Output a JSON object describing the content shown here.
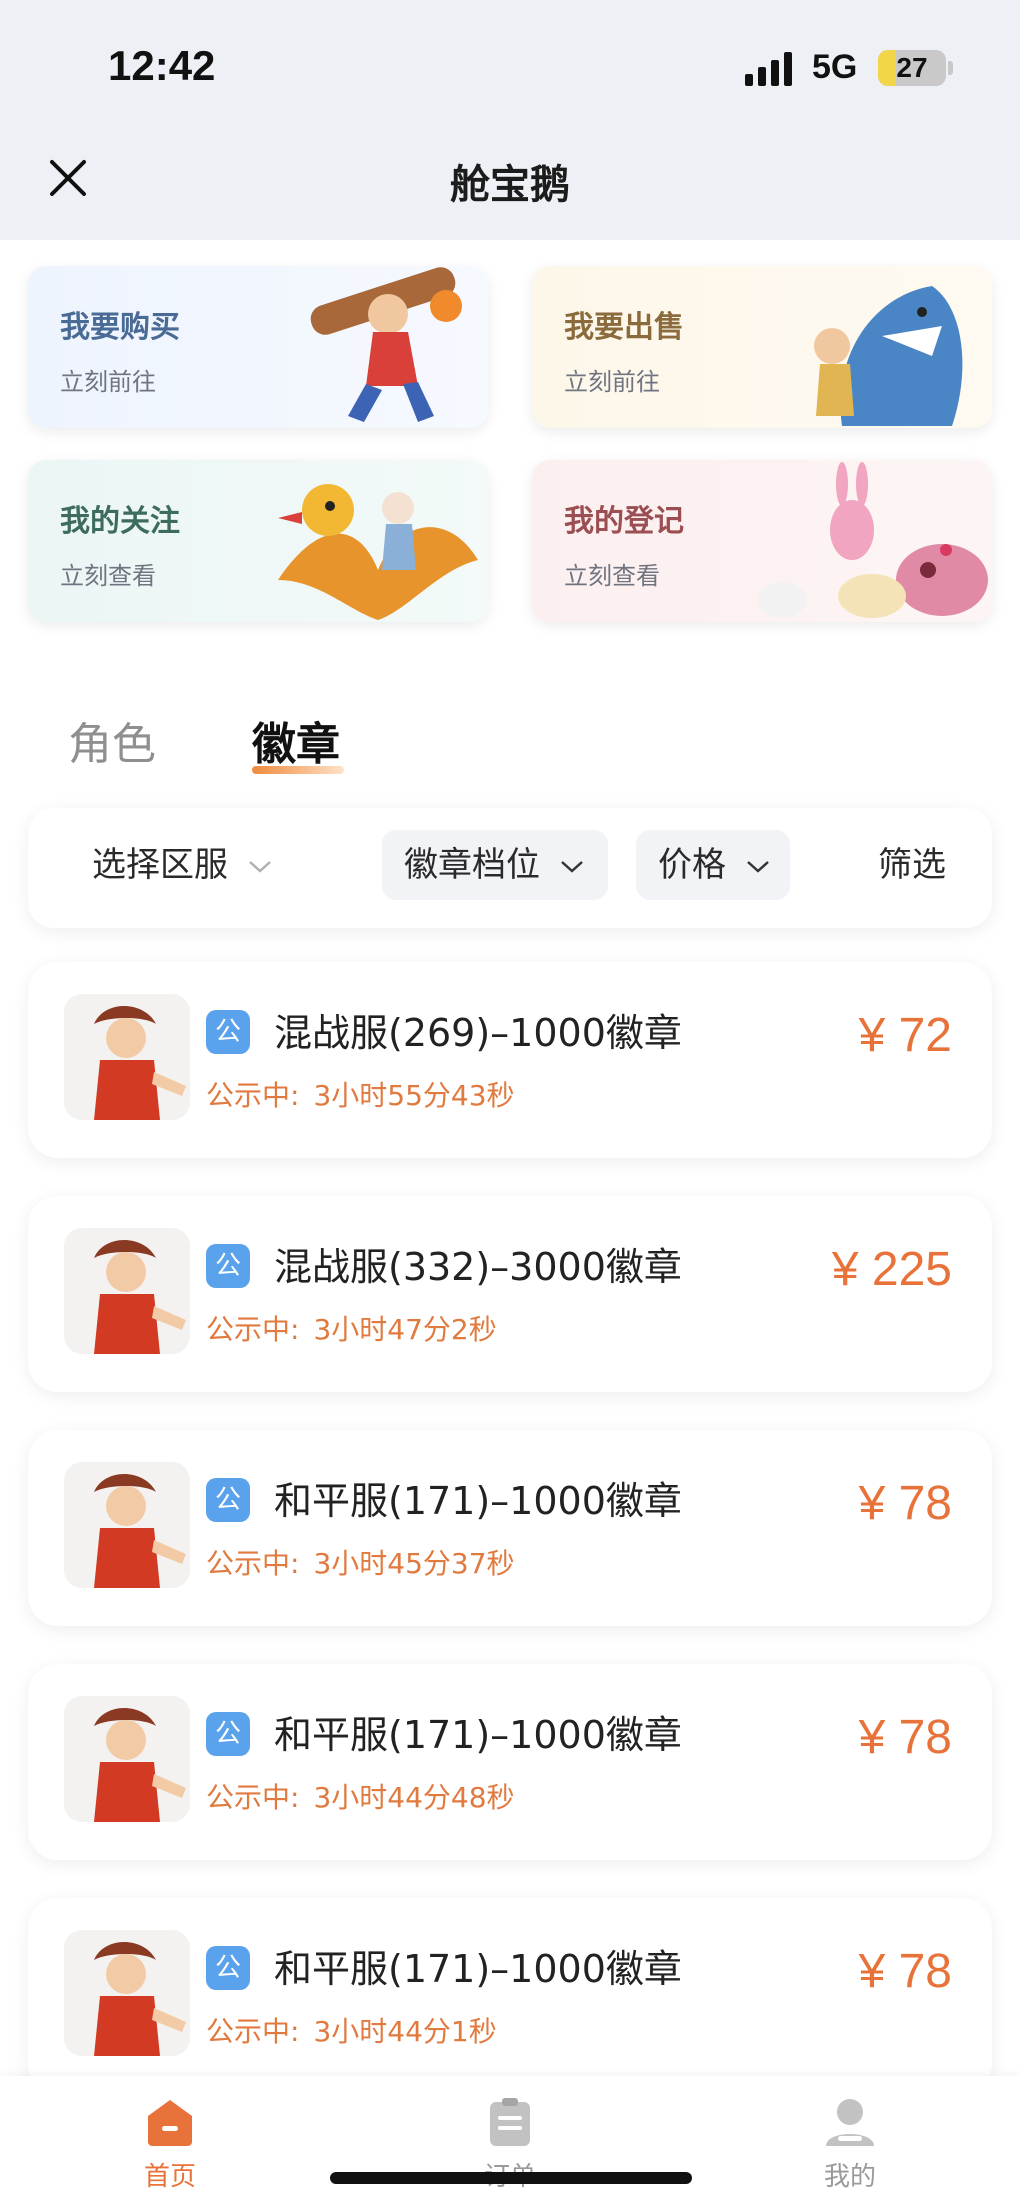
{
  "status_bar": {
    "time": "12:42",
    "network": "5G",
    "battery": "27",
    "battery_level": 0.27
  },
  "nav": {
    "title": "舱宝鹅",
    "close_icon": "close-icon"
  },
  "quick_cards": [
    {
      "title": "我要购买",
      "subtitle": "立刻前往"
    },
    {
      "title": "我要出售",
      "subtitle": "立刻前往"
    },
    {
      "title": "我的关注",
      "subtitle": "立刻查看"
    },
    {
      "title": "我的登记",
      "subtitle": "立刻查看"
    }
  ],
  "tabs": [
    {
      "label": "角色",
      "active": false
    },
    {
      "label": "徽章",
      "active": true
    }
  ],
  "filters": {
    "server": "选择区服",
    "tier": "徽章档位",
    "price": "价格",
    "filter": "筛选"
  },
  "listings": [
    {
      "tag": "公",
      "title": "混战服(269)–1000徽章",
      "status": "公示中:",
      "countdown": "3小时55分43秒",
      "price": "¥ 72"
    },
    {
      "tag": "公",
      "title": "混战服(332)–3000徽章",
      "status": "公示中:",
      "countdown": "3小时47分2秒",
      "price": "¥ 225"
    },
    {
      "tag": "公",
      "title": "和平服(171)–1000徽章",
      "status": "公示中:",
      "countdown": "3小时45分37秒",
      "price": "¥ 78"
    },
    {
      "tag": "公",
      "title": "和平服(171)–1000徽章",
      "status": "公示中:",
      "countdown": "3小时44分48秒",
      "price": "¥ 78"
    },
    {
      "tag": "公",
      "title": "和平服(171)–1000徽章",
      "status": "公示中:",
      "countdown": "3小时44分1秒",
      "price": "¥ 78"
    }
  ],
  "bottom_nav": [
    {
      "label": "首页",
      "icon": "home-icon",
      "active": true
    },
    {
      "label": "订单",
      "icon": "orders-icon",
      "active": false
    },
    {
      "label": "我的",
      "icon": "profile-icon",
      "active": false
    }
  ],
  "colors": {
    "accent": "#e8733a",
    "tag_blue": "#5aa3ec"
  }
}
